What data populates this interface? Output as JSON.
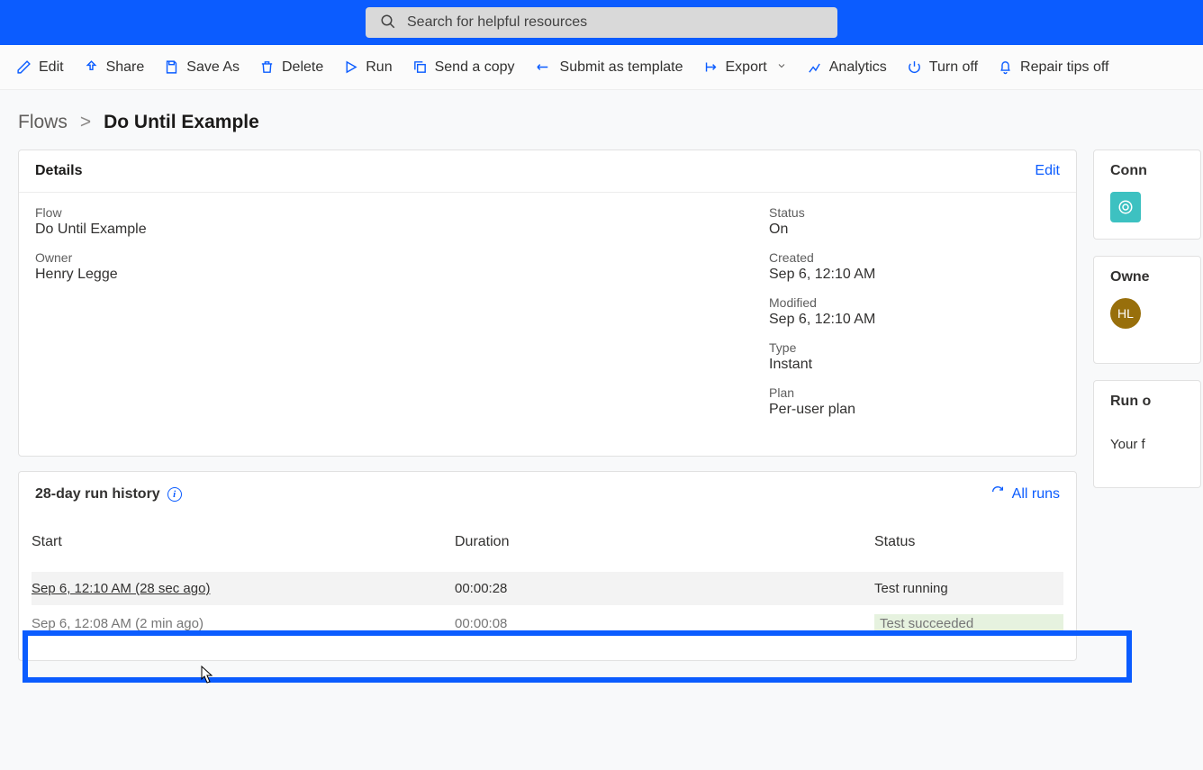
{
  "search": {
    "placeholder": "Search for helpful resources"
  },
  "commands": {
    "edit": "Edit",
    "share": "Share",
    "save_as": "Save As",
    "delete": "Delete",
    "run": "Run",
    "send_copy": "Send a copy",
    "submit_template": "Submit as template",
    "export": "Export",
    "analytics": "Analytics",
    "turn_off": "Turn off",
    "repair_tips": "Repair tips off"
  },
  "breadcrumb": {
    "root": "Flows",
    "sep": ">",
    "leaf": "Do Until Example"
  },
  "details": {
    "title": "Details",
    "edit_link": "Edit",
    "left": {
      "flow_label": "Flow",
      "flow_value": "Do Until Example",
      "owner_label": "Owner",
      "owner_value": "Henry Legge"
    },
    "right": {
      "status_label": "Status",
      "status_value": "On",
      "created_label": "Created",
      "created_value": "Sep 6, 12:10 AM",
      "modified_label": "Modified",
      "modified_value": "Sep 6, 12:10 AM",
      "type_label": "Type",
      "type_value": "Instant",
      "plan_label": "Plan",
      "plan_value": "Per-user plan"
    }
  },
  "run_history": {
    "title": "28-day run history",
    "all_runs": "All runs",
    "columns": {
      "start": "Start",
      "duration": "Duration",
      "status": "Status"
    },
    "rows": [
      {
        "start": "Sep 6, 12:10 AM (28 sec ago)",
        "duration": "00:00:28",
        "status": "Test running"
      },
      {
        "start": "Sep 6, 12:08 AM (2 min ago)",
        "duration": "00:00:08",
        "status": "Test succeeded"
      }
    ]
  },
  "sidebar": {
    "connections_title": "Conn",
    "owners_title": "Owne",
    "owner_initials": "HL",
    "run_only_title": "Run o",
    "run_only_text": "Your f"
  }
}
